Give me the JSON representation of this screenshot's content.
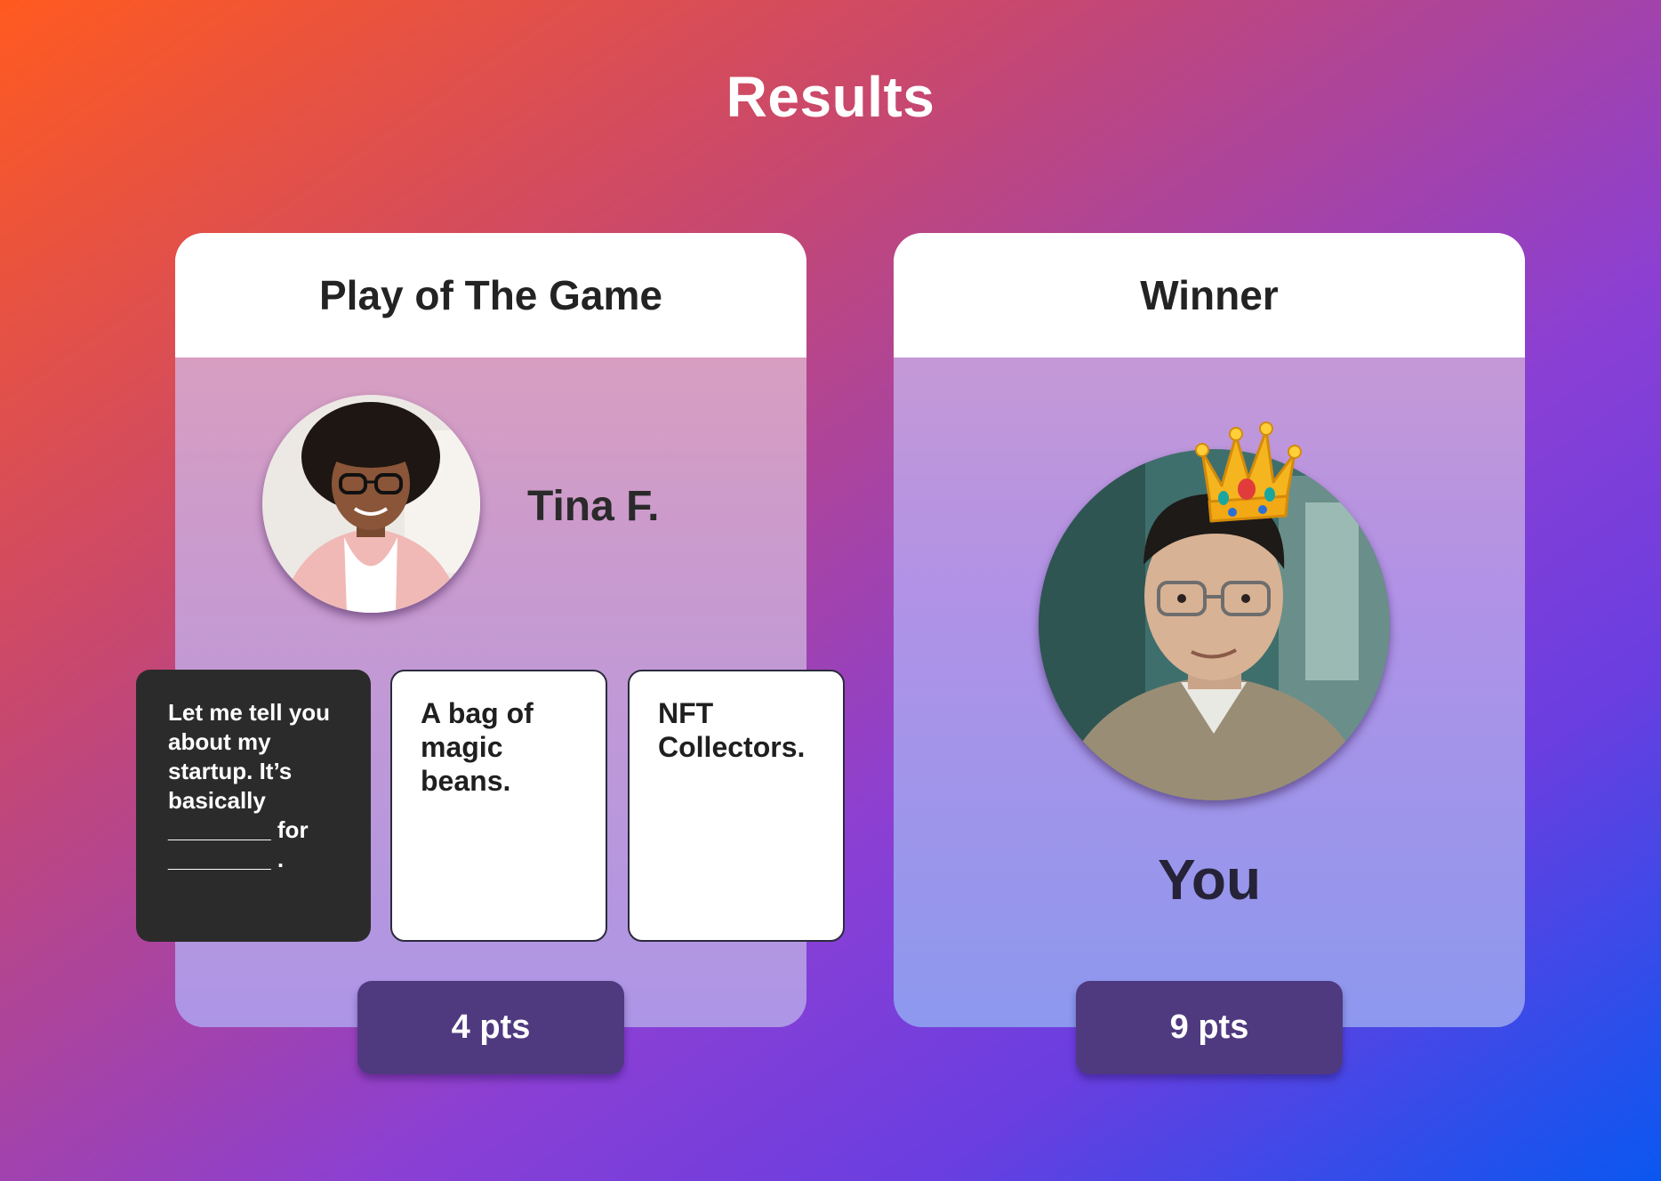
{
  "page": {
    "title": "Results"
  },
  "play_of_game": {
    "header": "Play of The Game",
    "player_name": "Tina F.",
    "black_card": {
      "lines": [
        "Let me tell you",
        "about my",
        "startup. It’s",
        "basically",
        "________ for",
        "________ ."
      ]
    },
    "white_cards": [
      "A bag of magic beans.",
      "NFT Collectors."
    ],
    "white_card_1_lines": [
      "A bag of",
      "magic",
      "beans."
    ],
    "white_card_2_lines": [
      "NFT",
      "Collectors."
    ],
    "points": "4 pts"
  },
  "winner": {
    "header": "Winner",
    "player_name": "You",
    "badge_icon": "crown-icon",
    "points": "9 pts"
  }
}
